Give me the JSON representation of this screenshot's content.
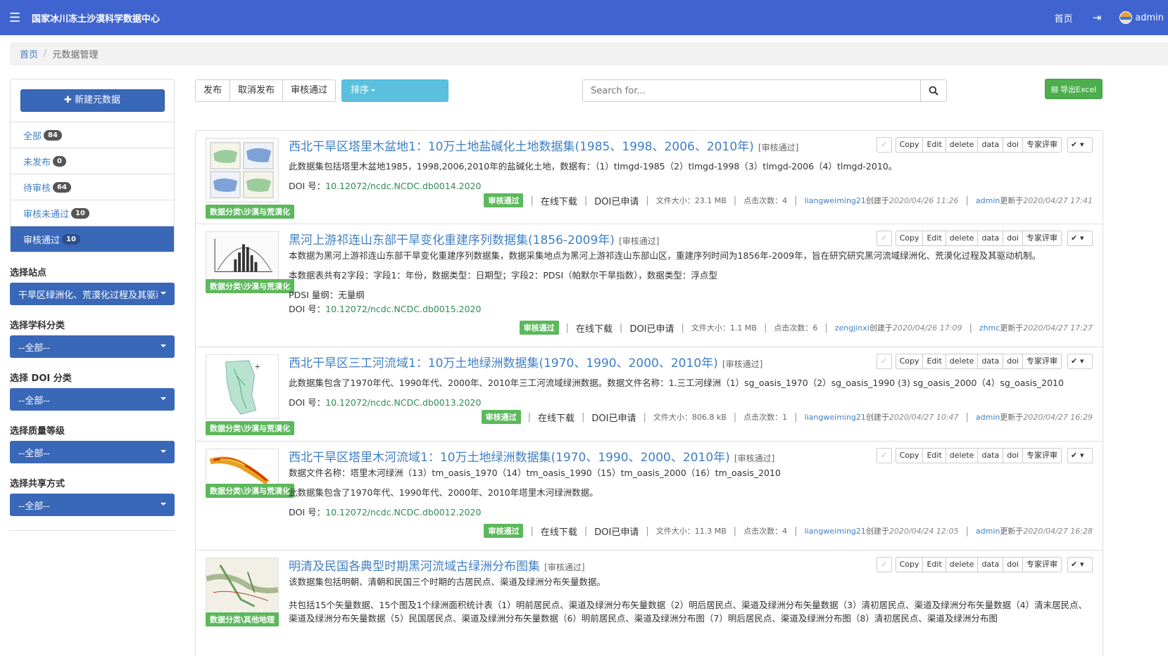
{
  "header": {
    "title": "国家冰川冻土沙漠科学数据中心",
    "home": "首页",
    "user": "admin"
  },
  "breadcrumb": {
    "home": "首页",
    "current": "元数据管理"
  },
  "sidebar": {
    "new_button": "✚ 新建元数据",
    "filters": [
      {
        "label": "全部",
        "count": "84"
      },
      {
        "label": "未发布",
        "count": "0"
      },
      {
        "label": "待审核",
        "count": "64"
      },
      {
        "label": "审核未通过",
        "count": "10"
      },
      {
        "label": "审核通过",
        "count": "10"
      }
    ],
    "selects": [
      {
        "label": "选择站点",
        "value": "干旱区绿洲化、荒漠化过程及其驱动机制"
      },
      {
        "label": "选择学科分类",
        "value": "--全部--"
      },
      {
        "label": "选择 DOI 分类",
        "value": "--全部--"
      },
      {
        "label": "选择质量等级",
        "value": "--全部--"
      },
      {
        "label": "选择共享方式",
        "value": "--全部--"
      }
    ]
  },
  "toolbar": {
    "publish": "发布",
    "unpublish": "取消发布",
    "approve": "审核通过",
    "sort": "排序",
    "search_placeholder": "Search for...",
    "export": "导出Excel"
  },
  "labels": {
    "status_tag": "[审核通过]",
    "doi_prefix": "DOI 号：",
    "status": "审核通过",
    "download": "在线下载",
    "doi_applied": "DOI已申请",
    "file_size": "文件大小：",
    "clicks": "点击次数：",
    "created": "创建于",
    "updated": "更新于",
    "actions": [
      "Copy",
      "Edit",
      "delete",
      "data",
      "doi",
      "专家评审"
    ]
  },
  "items": [
    {
      "title": "西北干旱区塔里木盆地1：10万土地盐碱化土地数据集(1985、1998、2006、2010年)",
      "desc1": "此数据集包括塔里木盆地1985，1998,2006,2010年的盐碱化土地，数据有：（1）tlmgd-1985（2）tlmgd-1998（3）tlmgd-2006（4）tlmgd-2010。",
      "doi": "10.12072/ncdc.NCDC.db0014.2020",
      "category": "数据分类\\沙漠与荒漠化",
      "size": "23.1 MB",
      "clicks": "4",
      "creator": "liangweiming21",
      "created_at": "2020/04/26 11:26",
      "updater": "admin",
      "updated_at": "2020/04/27 17:41"
    },
    {
      "title": "黑河上游祁连山东部干旱变化重建序列数据集(1856-2009年)",
      "desc1": "本数据为黑河上游祁连山东部干旱变化重建序列数据集，数据采集地点为黑河上游祁连山东部山区，重建序列时间为1856年-2009年，旨在研究研究黑河流域绿洲化、荒漠化过程及其驱动机制。",
      "desc2": "本数据表共有2字段：字段1：年份，数据类型：日期型；字段2：PDSI（帕默尔干旱指数），数据类型：浮点型",
      "desc3": "PDSI 量纲：无量纲",
      "doi": "10.12072/ncdc.NCDC.db0015.2020",
      "category": "数据分类\\沙漠与荒漠化",
      "size": "1.1 MB",
      "clicks": "6",
      "creator": "zengjinxi",
      "created_at": "2020/04/26 17:09",
      "updater": "zhmc",
      "updated_at": "2020/04/27 17:27"
    },
    {
      "title": "西北干旱区三工河流域1：10万土地绿洲数据集(1970、1990、2000、2010年)",
      "desc1": "此数据集包含了1970年代、1990年代、2000年、2010年三工河流域绿洲数据。数据文件名称：1.三工河绿洲（1）sg_oasis_1970（2）sg_oasis_1990 (3) sg_oasis_2000（4）sg_oasis_2010",
      "doi": "10.12072/ncdc.NCDC.db0013.2020",
      "category": "数据分类\\沙漠与荒漠化",
      "size": "806.8 kB",
      "clicks": "1",
      "creator": "liangweiming21",
      "created_at": "2020/04/27 10:47",
      "updater": "admin",
      "updated_at": "2020/04/27 16:29"
    },
    {
      "title": "西北干旱区塔里木河流域1：10万土地绿洲数据集(1970、1990、2000、2010年)",
      "desc1": "数据文件名称：塔里木河绿洲（13）tm_oasis_1970（14）tm_oasis_1990（15）tm_oasis_2000（16）tm_oasis_2010",
      "desc2": "此数据集包含了1970年代、1990年代、2000年、2010年塔里木河绿洲数据。",
      "doi": "10.12072/ncdc.NCDC.db0012.2020",
      "category": "数据分类\\沙漠与荒漠化",
      "size": "11.3 MB",
      "clicks": "4",
      "creator": "liangweiming21",
      "created_at": "2020/04/24 12:05",
      "updater": "admin",
      "updated_at": "2020/04/27 16:28"
    },
    {
      "title": "明清及民国各典型时期黑河流域古绿洲分布图集",
      "desc1": "该数据集包括明朝、清朝和民国三个时期的古居民点、渠道及绿洲分布矢量数据。",
      "desc2": "共包括15个矢量数据、15个图及1个绿洲面积统计表（1）明前居民点、渠道及绿洲分布矢量数据（2）明后居民点、渠道及绿洲分布矢量数据（3）清初居民点、渠道及绿洲分布矢量数据（4）清末居民点、渠道及绿洲分布矢量数据（5）民国居民点、渠道及绿洲分布矢量数据（6）明前居民点、渠道及绿洲分布图（7）明后居民点、渠道及绿洲分布图（8）清初居民点、渠道及绿洲分布图",
      "category": "数据分类\\其他地理"
    }
  ]
}
